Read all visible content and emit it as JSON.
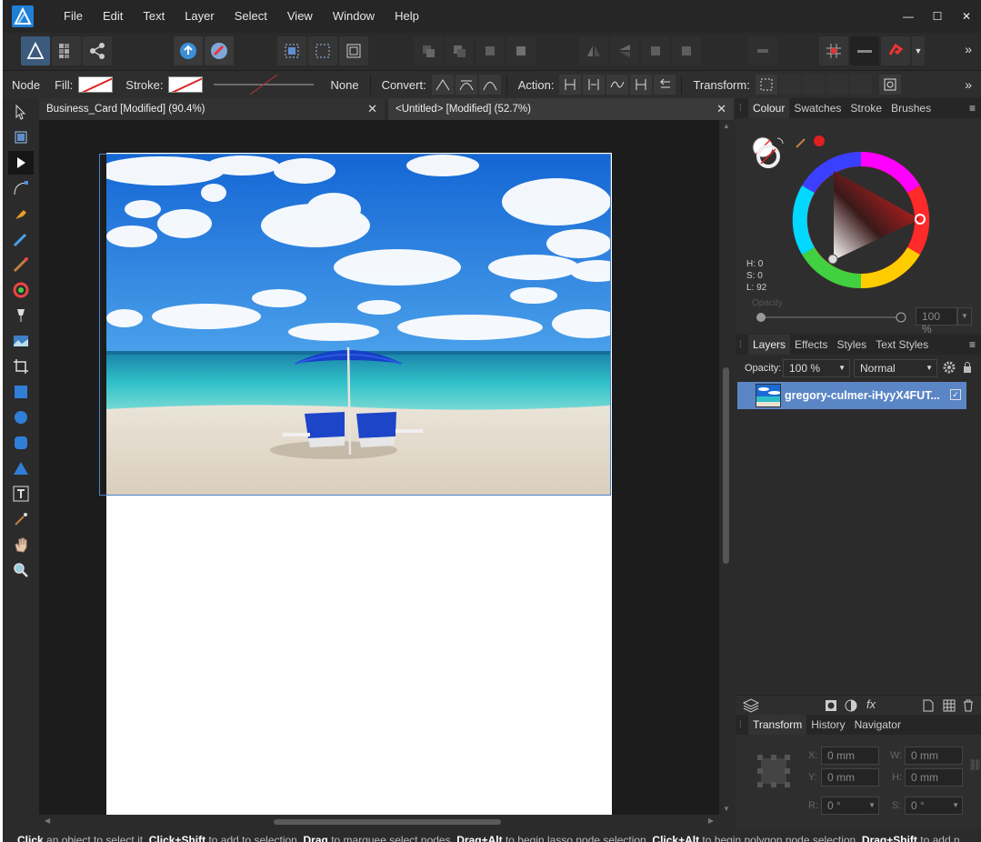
{
  "menu": {
    "items": [
      "File",
      "Edit",
      "Text",
      "Layer",
      "Select",
      "View",
      "Window",
      "Help"
    ]
  },
  "window_controls": {
    "minimize": "—",
    "maximize": "☐",
    "close": "✕"
  },
  "toolbar": {
    "overflow": "»"
  },
  "context_bar": {
    "tool_name": "Node",
    "fill_label": "Fill:",
    "stroke_label": "Stroke:",
    "stroke_value": "None",
    "convert_label": "Convert:",
    "action_label": "Action:",
    "transform_label": "Transform:",
    "overflow": "»"
  },
  "document_tabs": [
    {
      "label": "Business_Card [Modified] (90.4%)",
      "close": "✕"
    },
    {
      "label": "<Untitled> [Modified] (52.7%)",
      "close": "✕"
    }
  ],
  "colour_panel": {
    "tabs": [
      "Colour",
      "Swatches",
      "Stroke",
      "Brushes"
    ],
    "h": "H: 0",
    "s": "S: 0",
    "l": "L: 92",
    "opacity_label": "Opacity",
    "opacity_value": "100 %",
    "accent": "#e02020"
  },
  "layers_panel": {
    "tabs": [
      "Layers",
      "Effects",
      "Styles",
      "Text Styles"
    ],
    "opacity_label": "Opacity:",
    "opacity_value": "100 %",
    "blend_mode": "Normal",
    "layer": {
      "name": "gregory-culmer-iHyyX4FUT...",
      "visible_mark": "✓",
      "selected_color": "#5b86c6"
    }
  },
  "transform_panel": {
    "tabs": [
      "Transform",
      "History",
      "Navigator"
    ],
    "x_label": "X:",
    "x_value": "0 mm",
    "y_label": "Y:",
    "y_value": "0 mm",
    "w_label": "W:",
    "w_value": "0 mm",
    "h_label": "H:",
    "h_value": "0 mm",
    "r_label": "R:",
    "r_value": "0 °",
    "s_label": "S:",
    "s_value": "0 °"
  },
  "status_bar": {
    "click": "Click",
    "t1": " an object to select it. ",
    "click_shift": "Click+Shift",
    "t2": " to add to selection. ",
    "drag": "Drag",
    "t3": " to marquee select nodes. ",
    "drag_alt": "Drag+Alt",
    "t4": " to begin lasso node selection. ",
    "click_alt": "Click+Alt",
    "t5": " to begin polygon node selection. ",
    "drag_shift": "Drag+Shift",
    "t6": " to add n"
  }
}
